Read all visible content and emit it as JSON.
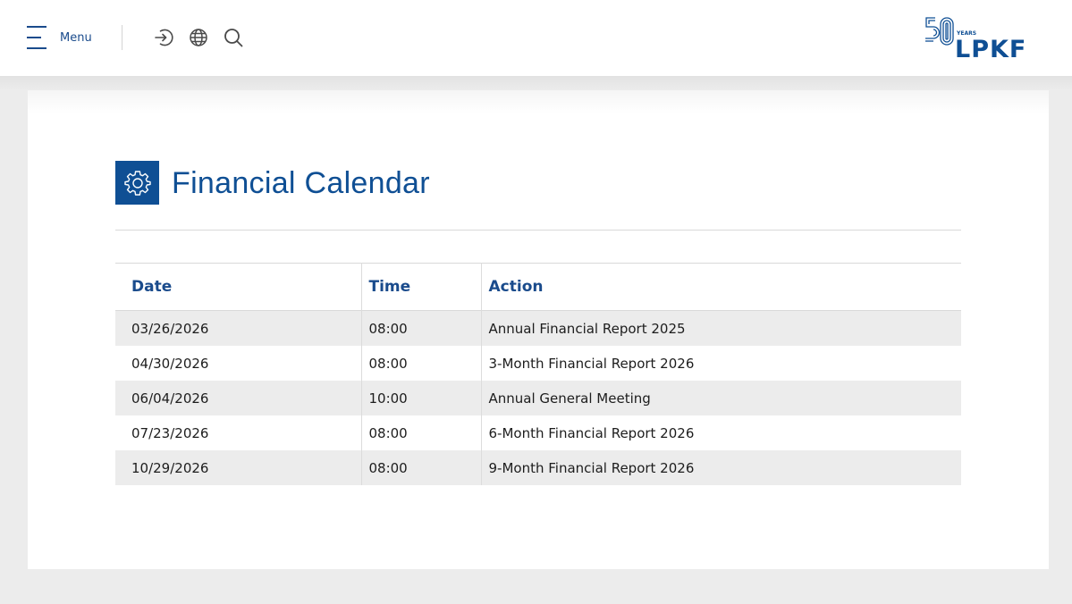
{
  "header": {
    "menu_label": "Menu",
    "icons": [
      "login-icon",
      "globe-icon",
      "search-icon"
    ]
  },
  "logo": {
    "anniversary_number": "50",
    "anniversary_label": "YEARS",
    "brand": "LPKF"
  },
  "colors": {
    "brand_blue": "#0f4f94",
    "header_text_blue": "#1a4b8c",
    "stripe_gray": "#ececec"
  },
  "page": {
    "title": "Financial Calendar",
    "title_icon": "gear-icon"
  },
  "calendar": {
    "columns": [
      "Date",
      "Time",
      "Action"
    ],
    "rows": [
      {
        "date": "03/26/2026",
        "time": "08:00",
        "action": "Annual Financial Report 2025"
      },
      {
        "date": "04/30/2026",
        "time": "08:00",
        "action": "3-Month Financial Report 2026"
      },
      {
        "date": "06/04/2026",
        "time": "10:00",
        "action": "Annual General Meeting"
      },
      {
        "date": "07/23/2026",
        "time": "08:00",
        "action": "6-Month Financial Report 2026"
      },
      {
        "date": "10/29/2026",
        "time": "08:00",
        "action": "9-Month Financial Report 2026"
      }
    ]
  }
}
